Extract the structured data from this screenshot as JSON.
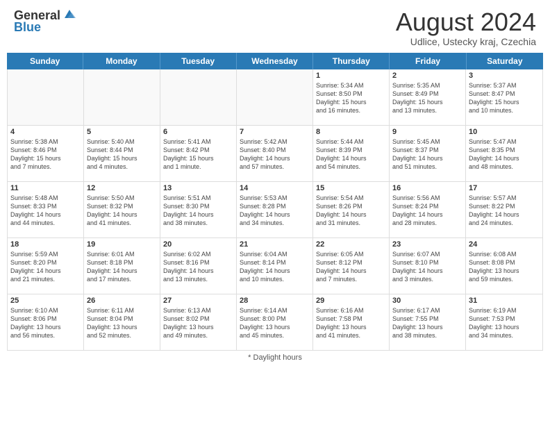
{
  "header": {
    "logo_general": "General",
    "logo_blue": "Blue",
    "month_year": "August 2024",
    "location": "Udlice, Ustecky kraj, Czechia"
  },
  "days_of_week": [
    "Sunday",
    "Monday",
    "Tuesday",
    "Wednesday",
    "Thursday",
    "Friday",
    "Saturday"
  ],
  "weeks": [
    [
      {
        "day": "",
        "lines": [],
        "empty": true
      },
      {
        "day": "",
        "lines": [],
        "empty": true
      },
      {
        "day": "",
        "lines": [],
        "empty": true
      },
      {
        "day": "",
        "lines": [],
        "empty": true
      },
      {
        "day": "1",
        "lines": [
          "Sunrise: 5:34 AM",
          "Sunset: 8:50 PM",
          "Daylight: 15 hours",
          "and 16 minutes."
        ],
        "empty": false
      },
      {
        "day": "2",
        "lines": [
          "Sunrise: 5:35 AM",
          "Sunset: 8:49 PM",
          "Daylight: 15 hours",
          "and 13 minutes."
        ],
        "empty": false
      },
      {
        "day": "3",
        "lines": [
          "Sunrise: 5:37 AM",
          "Sunset: 8:47 PM",
          "Daylight: 15 hours",
          "and 10 minutes."
        ],
        "empty": false
      }
    ],
    [
      {
        "day": "4",
        "lines": [
          "Sunrise: 5:38 AM",
          "Sunset: 8:46 PM",
          "Daylight: 15 hours",
          "and 7 minutes."
        ],
        "empty": false
      },
      {
        "day": "5",
        "lines": [
          "Sunrise: 5:40 AM",
          "Sunset: 8:44 PM",
          "Daylight: 15 hours",
          "and 4 minutes."
        ],
        "empty": false
      },
      {
        "day": "6",
        "lines": [
          "Sunrise: 5:41 AM",
          "Sunset: 8:42 PM",
          "Daylight: 15 hours",
          "and 1 minute."
        ],
        "empty": false
      },
      {
        "day": "7",
        "lines": [
          "Sunrise: 5:42 AM",
          "Sunset: 8:40 PM",
          "Daylight: 14 hours",
          "and 57 minutes."
        ],
        "empty": false
      },
      {
        "day": "8",
        "lines": [
          "Sunrise: 5:44 AM",
          "Sunset: 8:39 PM",
          "Daylight: 14 hours",
          "and 54 minutes."
        ],
        "empty": false
      },
      {
        "day": "9",
        "lines": [
          "Sunrise: 5:45 AM",
          "Sunset: 8:37 PM",
          "Daylight: 14 hours",
          "and 51 minutes."
        ],
        "empty": false
      },
      {
        "day": "10",
        "lines": [
          "Sunrise: 5:47 AM",
          "Sunset: 8:35 PM",
          "Daylight: 14 hours",
          "and 48 minutes."
        ],
        "empty": false
      }
    ],
    [
      {
        "day": "11",
        "lines": [
          "Sunrise: 5:48 AM",
          "Sunset: 8:33 PM",
          "Daylight: 14 hours",
          "and 44 minutes."
        ],
        "empty": false
      },
      {
        "day": "12",
        "lines": [
          "Sunrise: 5:50 AM",
          "Sunset: 8:32 PM",
          "Daylight: 14 hours",
          "and 41 minutes."
        ],
        "empty": false
      },
      {
        "day": "13",
        "lines": [
          "Sunrise: 5:51 AM",
          "Sunset: 8:30 PM",
          "Daylight: 14 hours",
          "and 38 minutes."
        ],
        "empty": false
      },
      {
        "day": "14",
        "lines": [
          "Sunrise: 5:53 AM",
          "Sunset: 8:28 PM",
          "Daylight: 14 hours",
          "and 34 minutes."
        ],
        "empty": false
      },
      {
        "day": "15",
        "lines": [
          "Sunrise: 5:54 AM",
          "Sunset: 8:26 PM",
          "Daylight: 14 hours",
          "and 31 minutes."
        ],
        "empty": false
      },
      {
        "day": "16",
        "lines": [
          "Sunrise: 5:56 AM",
          "Sunset: 8:24 PM",
          "Daylight: 14 hours",
          "and 28 minutes."
        ],
        "empty": false
      },
      {
        "day": "17",
        "lines": [
          "Sunrise: 5:57 AM",
          "Sunset: 8:22 PM",
          "Daylight: 14 hours",
          "and 24 minutes."
        ],
        "empty": false
      }
    ],
    [
      {
        "day": "18",
        "lines": [
          "Sunrise: 5:59 AM",
          "Sunset: 8:20 PM",
          "Daylight: 14 hours",
          "and 21 minutes."
        ],
        "empty": false
      },
      {
        "day": "19",
        "lines": [
          "Sunrise: 6:01 AM",
          "Sunset: 8:18 PM",
          "Daylight: 14 hours",
          "and 17 minutes."
        ],
        "empty": false
      },
      {
        "day": "20",
        "lines": [
          "Sunrise: 6:02 AM",
          "Sunset: 8:16 PM",
          "Daylight: 14 hours",
          "and 13 minutes."
        ],
        "empty": false
      },
      {
        "day": "21",
        "lines": [
          "Sunrise: 6:04 AM",
          "Sunset: 8:14 PM",
          "Daylight: 14 hours",
          "and 10 minutes."
        ],
        "empty": false
      },
      {
        "day": "22",
        "lines": [
          "Sunrise: 6:05 AM",
          "Sunset: 8:12 PM",
          "Daylight: 14 hours",
          "and 7 minutes."
        ],
        "empty": false
      },
      {
        "day": "23",
        "lines": [
          "Sunrise: 6:07 AM",
          "Sunset: 8:10 PM",
          "Daylight: 14 hours",
          "and 3 minutes."
        ],
        "empty": false
      },
      {
        "day": "24",
        "lines": [
          "Sunrise: 6:08 AM",
          "Sunset: 8:08 PM",
          "Daylight: 13 hours",
          "and 59 minutes."
        ],
        "empty": false
      }
    ],
    [
      {
        "day": "25",
        "lines": [
          "Sunrise: 6:10 AM",
          "Sunset: 8:06 PM",
          "Daylight: 13 hours",
          "and 56 minutes."
        ],
        "empty": false
      },
      {
        "day": "26",
        "lines": [
          "Sunrise: 6:11 AM",
          "Sunset: 8:04 PM",
          "Daylight: 13 hours",
          "and 52 minutes."
        ],
        "empty": false
      },
      {
        "day": "27",
        "lines": [
          "Sunrise: 6:13 AM",
          "Sunset: 8:02 PM",
          "Daylight: 13 hours",
          "and 49 minutes."
        ],
        "empty": false
      },
      {
        "day": "28",
        "lines": [
          "Sunrise: 6:14 AM",
          "Sunset: 8:00 PM",
          "Daylight: 13 hours",
          "and 45 minutes."
        ],
        "empty": false
      },
      {
        "day": "29",
        "lines": [
          "Sunrise: 6:16 AM",
          "Sunset: 7:58 PM",
          "Daylight: 13 hours",
          "and 41 minutes."
        ],
        "empty": false
      },
      {
        "day": "30",
        "lines": [
          "Sunrise: 6:17 AM",
          "Sunset: 7:55 PM",
          "Daylight: 13 hours",
          "and 38 minutes."
        ],
        "empty": false
      },
      {
        "day": "31",
        "lines": [
          "Sunrise: 6:19 AM",
          "Sunset: 7:53 PM",
          "Daylight: 13 hours",
          "and 34 minutes."
        ],
        "empty": false
      }
    ]
  ],
  "footer": {
    "note": "Daylight hours"
  }
}
